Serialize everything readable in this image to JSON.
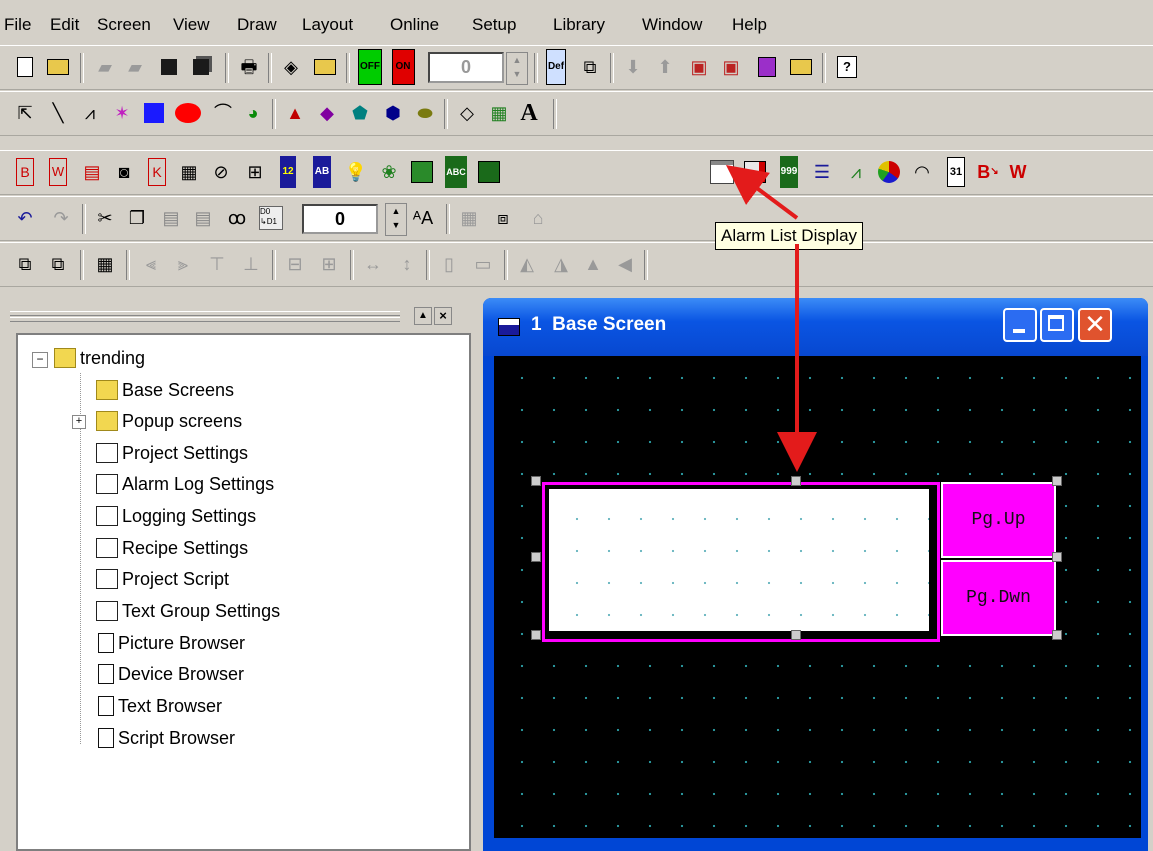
{
  "menu": [
    "File",
    "Edit",
    "Screen",
    "View",
    "Draw",
    "Layout",
    "Online",
    "Setup",
    "Library",
    "Window",
    "Help"
  ],
  "toolbar": {
    "off_label": "OFF",
    "on_label": "ON",
    "spin1_value": "0",
    "def_label": "Def",
    "spin2_value": "0",
    "num_label": "12",
    "ab_label": "AB",
    "abc_label": "ABC",
    "count_label": "999",
    "cal_label": "31",
    "text_a": "A"
  },
  "tooltip": "Alarm List Display",
  "tree": {
    "root": "trending",
    "items": [
      "Base Screens",
      "Popup screens",
      "Project Settings",
      "Alarm Log Settings",
      "Logging Settings",
      "Recipe Settings",
      "Project Script",
      "Text Group Settings",
      "Picture Browser",
      "Device Browser",
      "Text Browser",
      "Script Browser"
    ]
  },
  "window": {
    "title": "1  Base Screen",
    "btn_up": "Pg.Up",
    "btn_down": "Pg.Dwn"
  },
  "colors": {
    "accent": "#0a55e3",
    "magenta": "#ff00ff",
    "arrow": "#e31b1b"
  }
}
